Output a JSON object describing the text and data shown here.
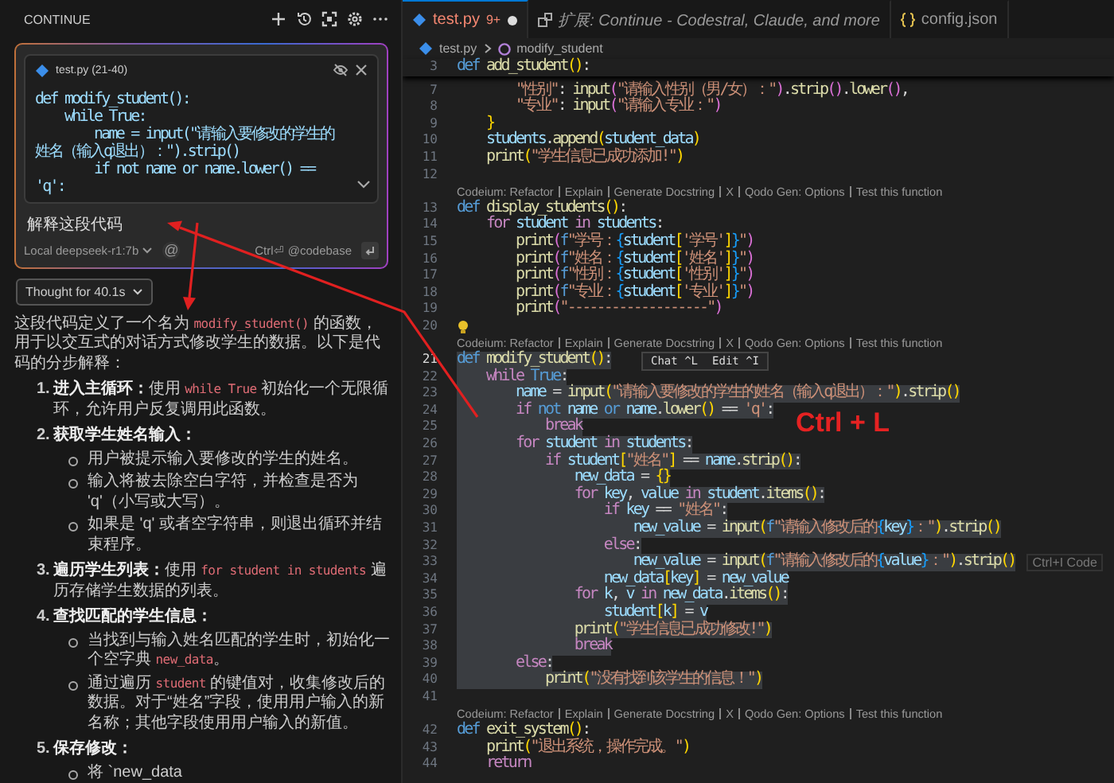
{
  "chat_panel": {
    "title": "CONTINUE",
    "context": {
      "file": "test.py (21-40)",
      "code": [
        "def modify_student():",
        "    while True:",
        "        name = input(\"请输入要修改的学生的姓名（输入q退出）：\").strip()",
        "        if not name or name.lower() == 'q':"
      ]
    },
    "prompt": "解释这段代码",
    "model": "Local deepseek-r1:7b",
    "mention": "@",
    "shortcut_hint": "Ctrl⏎ @codebase",
    "thought": "Thought for 40.1s",
    "answer": {
      "intro": [
        {
          "text": "这段代码定义了一个名为 ",
          "kind": "text"
        },
        {
          "text": "modify_student()",
          "kind": "code"
        },
        {
          "text": " 的函数，用于以交互式的对话方式修改学生的数据。以下是代码的分步解释：",
          "kind": "text"
        }
      ],
      "steps": [
        {
          "number": "1.",
          "title": "进入主循环：",
          "body": [
            {
              "text": "使用 ",
              "kind": "text"
            },
            {
              "text": "while True",
              "kind": "code"
            },
            {
              "text": " 初始化一个无限循环，允许用户反复调用此函数。",
              "kind": "text"
            }
          ]
        },
        {
          "number": "2.",
          "title": "获取学生姓名输入：",
          "bullets": [
            [
              {
                "text": "用户被提示输入要修改的学生的姓名。",
                "kind": "text"
              }
            ],
            [
              {
                "text": "输入将被去除空白字符，并检查是否为 'q'（小写或大写）。",
                "kind": "text"
              }
            ],
            [
              {
                "text": "如果是 'q' 或者空字符串，则退出循环并结束程序。",
                "kind": "text"
              }
            ]
          ]
        },
        {
          "number": "3.",
          "title": "遍历学生列表：",
          "body": [
            {
              "text": "使用 ",
              "kind": "text"
            },
            {
              "text": "for student in students",
              "kind": "code"
            },
            {
              "text": " 遍历存储学生数据的列表。",
              "kind": "text"
            }
          ]
        },
        {
          "number": "4.",
          "title": "查找匹配的学生信息：",
          "bullets": [
            [
              {
                "text": "当找到与输入姓名匹配的学生时，初始化一个空字典 ",
                "kind": "text"
              },
              {
                "text": "new_data",
                "kind": "code"
              },
              {
                "text": "。",
                "kind": "text"
              }
            ],
            [
              {
                "text": "通过遍历 ",
                "kind": "text"
              },
              {
                "text": "student",
                "kind": "code"
              },
              {
                "text": " 的键值对，收集修改后的数据。对于“姓名”字段，使用用户输入的新名称；其他字段使用用户输入的新值。",
                "kind": "text"
              }
            ]
          ]
        },
        {
          "number": "5.",
          "title": "保存修改：",
          "bullets": [
            [
              {
                "text": "将 `new_data",
                "kind": "text"
              }
            ]
          ]
        }
      ]
    }
  },
  "editor": {
    "tabs": [
      {
        "label": "test.py",
        "kind": "python",
        "badge": "9+",
        "modified": true,
        "preview": false,
        "selected": true
      },
      {
        "label": "扩展: Continue - Codestral, Claude, and more",
        "kind": "extension",
        "modified": false,
        "preview": true,
        "selected": false
      },
      {
        "label": "config.json",
        "kind": "json",
        "modified": false,
        "preview": false,
        "selected": false
      }
    ],
    "breadcrumb": [
      "test.py",
      "modify_student"
    ],
    "sticky_line": {
      "kind": "code",
      "number": "3",
      "selected": false,
      "current": false,
      "tokens": [
        {
          "text": "def ",
          "kind": "kw"
        },
        {
          "text": "add_student",
          "kind": "fn"
        },
        {
          "text": "()",
          "kind": "b1"
        },
        {
          "text": ":",
          "kind": "p"
        }
      ]
    },
    "rows": [
      {
        "kind": "code",
        "number": "7",
        "selected": false,
        "current": false,
        "tokens": [
          {
            "text": "        \"性别\"",
            "kind": "str"
          },
          {
            "text": ": ",
            "kind": "p"
          },
          {
            "text": "input",
            "kind": "fn"
          },
          {
            "text": "(",
            "kind": "b2"
          },
          {
            "text": "\"请输入性别（男/女）：\"",
            "kind": "str"
          },
          {
            "text": ")",
            "kind": "b2"
          },
          {
            "text": ".",
            "kind": "p"
          },
          {
            "text": "strip",
            "kind": "fn"
          },
          {
            "text": "()",
            "kind": "b2"
          },
          {
            "text": ".",
            "kind": "p"
          },
          {
            "text": "lower",
            "kind": "fn"
          },
          {
            "text": "()",
            "kind": "b2"
          },
          {
            "text": ",",
            "kind": "p"
          }
        ]
      },
      {
        "kind": "code",
        "number": "8",
        "selected": false,
        "current": false,
        "tokens": [
          {
            "text": "        \"专业\"",
            "kind": "str"
          },
          {
            "text": ": ",
            "kind": "p"
          },
          {
            "text": "input",
            "kind": "fn"
          },
          {
            "text": "(",
            "kind": "b2"
          },
          {
            "text": "\"请输入专业：\"",
            "kind": "str"
          },
          {
            "text": ")",
            "kind": "b2"
          }
        ]
      },
      {
        "kind": "code",
        "number": "9",
        "selected": false,
        "current": false,
        "tokens": [
          {
            "text": "    }",
            "kind": "b1"
          }
        ]
      },
      {
        "kind": "code",
        "number": "10",
        "selected": false,
        "current": false,
        "tokens": [
          {
            "text": "    students",
            "kind": "var"
          },
          {
            "text": ".",
            "kind": "p"
          },
          {
            "text": "append",
            "kind": "fn"
          },
          {
            "text": "(",
            "kind": "b1"
          },
          {
            "text": "student_data",
            "kind": "var"
          },
          {
            "text": ")",
            "kind": "b1"
          }
        ]
      },
      {
        "kind": "code",
        "number": "11",
        "selected": false,
        "current": false,
        "tokens": [
          {
            "text": "    print",
            "kind": "fn"
          },
          {
            "text": "(",
            "kind": "b1"
          },
          {
            "text": "\"学生信息已成功添加!\"",
            "kind": "str"
          },
          {
            "text": ")",
            "kind": "b1"
          }
        ]
      },
      {
        "kind": "code",
        "number": "12",
        "selected": false,
        "current": false
      },
      {
        "kind": "lens",
        "items": [
          "Codeium: Refactor",
          "Explain",
          "Generate Docstring",
          "X",
          "Qodo Gen: Options",
          "Test this function"
        ]
      },
      {
        "kind": "code",
        "number": "13",
        "selected": false,
        "current": false,
        "tokens": [
          {
            "text": "def ",
            "kind": "kw"
          },
          {
            "text": "display_students",
            "kind": "fn"
          },
          {
            "text": "()",
            "kind": "b1"
          },
          {
            "text": ":",
            "kind": "p"
          }
        ]
      },
      {
        "kind": "code",
        "number": "14",
        "selected": false,
        "current": false,
        "tokens": [
          {
            "text": "    for ",
            "kind": "ctl"
          },
          {
            "text": "student ",
            "kind": "var"
          },
          {
            "text": "in ",
            "kind": "ctl"
          },
          {
            "text": "students",
            "kind": "var"
          },
          {
            "text": ":",
            "kind": "p"
          }
        ]
      },
      {
        "kind": "code",
        "number": "15",
        "selected": false,
        "current": false,
        "tokens": [
          {
            "text": "        print",
            "kind": "fn"
          },
          {
            "text": "(",
            "kind": "b2"
          },
          {
            "text": "f",
            "kind": "kw"
          },
          {
            "text": "\"学号：",
            "kind": "str"
          },
          {
            "text": "{",
            "kind": "b3"
          },
          {
            "text": "student",
            "kind": "var"
          },
          {
            "text": "[",
            "kind": "b1"
          },
          {
            "text": "'学号'",
            "kind": "str"
          },
          {
            "text": "]",
            "kind": "b1"
          },
          {
            "text": "}",
            "kind": "b3"
          },
          {
            "text": "\"",
            "kind": "str"
          },
          {
            "text": ")",
            "kind": "b2"
          }
        ]
      },
      {
        "kind": "code",
        "number": "16",
        "selected": false,
        "current": false,
        "tokens": [
          {
            "text": "        print",
            "kind": "fn"
          },
          {
            "text": "(",
            "kind": "b2"
          },
          {
            "text": "f",
            "kind": "kw"
          },
          {
            "text": "\"姓名：",
            "kind": "str"
          },
          {
            "text": "{",
            "kind": "b3"
          },
          {
            "text": "student",
            "kind": "var"
          },
          {
            "text": "[",
            "kind": "b1"
          },
          {
            "text": "'姓名'",
            "kind": "str"
          },
          {
            "text": "]",
            "kind": "b1"
          },
          {
            "text": "}",
            "kind": "b3"
          },
          {
            "text": "\"",
            "kind": "str"
          },
          {
            "text": ")",
            "kind": "b2"
          }
        ]
      },
      {
        "kind": "code",
        "number": "17",
        "selected": false,
        "current": false,
        "tokens": [
          {
            "text": "        print",
            "kind": "fn"
          },
          {
            "text": "(",
            "kind": "b2"
          },
          {
            "text": "f",
            "kind": "kw"
          },
          {
            "text": "\"性别：",
            "kind": "str"
          },
          {
            "text": "{",
            "kind": "b3"
          },
          {
            "text": "student",
            "kind": "var"
          },
          {
            "text": "[",
            "kind": "b1"
          },
          {
            "text": "'性别'",
            "kind": "str"
          },
          {
            "text": "]",
            "kind": "b1"
          },
          {
            "text": "}",
            "kind": "b3"
          },
          {
            "text": "\"",
            "kind": "str"
          },
          {
            "text": ")",
            "kind": "b2"
          }
        ]
      },
      {
        "kind": "code",
        "number": "18",
        "selected": false,
        "current": false,
        "tokens": [
          {
            "text": "        print",
            "kind": "fn"
          },
          {
            "text": "(",
            "kind": "b2"
          },
          {
            "text": "f",
            "kind": "kw"
          },
          {
            "text": "\"专业：",
            "kind": "str"
          },
          {
            "text": "{",
            "kind": "b3"
          },
          {
            "text": "student",
            "kind": "var"
          },
          {
            "text": "[",
            "kind": "b1"
          },
          {
            "text": "'专业'",
            "kind": "str"
          },
          {
            "text": "]",
            "kind": "b1"
          },
          {
            "text": "}",
            "kind": "b3"
          },
          {
            "text": "\"",
            "kind": "str"
          },
          {
            "text": ")",
            "kind": "b2"
          }
        ]
      },
      {
        "kind": "code",
        "number": "19",
        "selected": false,
        "current": false,
        "tokens": [
          {
            "text": "        print",
            "kind": "fn"
          },
          {
            "text": "(",
            "kind": "b2"
          },
          {
            "text": "\"-------------------\"",
            "kind": "str"
          },
          {
            "text": ")",
            "kind": "b2"
          }
        ]
      },
      {
        "kind": "code",
        "number": "20",
        "selected": false,
        "current": false,
        "lightbulb": true
      },
      {
        "kind": "lens",
        "items": [
          "Codeium: Refactor",
          "Explain",
          "Generate Docstring",
          "X",
          "Qodo Gen: Options",
          "Test this function"
        ]
      },
      {
        "kind": "code",
        "number": "21",
        "selected": true,
        "current": true,
        "actions": [
          "Chat ^L",
          "Edit ^I"
        ],
        "tokens": [
          {
            "text": "def ",
            "kind": "kw"
          },
          {
            "text": "modify_student",
            "kind": "fn"
          },
          {
            "text": "()",
            "kind": "b1"
          },
          {
            "text": ":",
            "kind": "p"
          }
        ]
      },
      {
        "kind": "code",
        "number": "22",
        "selected": true,
        "current": false,
        "tokens": [
          {
            "text": "    while ",
            "kind": "ctl"
          },
          {
            "text": "True",
            "kind": "kw"
          },
          {
            "text": ":",
            "kind": "p"
          }
        ]
      },
      {
        "kind": "code",
        "number": "23",
        "selected": true,
        "current": false,
        "tokens": [
          {
            "text": "        name",
            "kind": "var"
          },
          {
            "text": " = ",
            "kind": "p"
          },
          {
            "text": "input",
            "kind": "fn"
          },
          {
            "text": "(",
            "kind": "b1"
          },
          {
            "text": "\"请输入要修改的学生的姓名（输入q退出）：\"",
            "kind": "str"
          },
          {
            "text": ")",
            "kind": "b1"
          },
          {
            "text": ".",
            "kind": "p"
          },
          {
            "text": "strip",
            "kind": "fn"
          },
          {
            "text": "()",
            "kind": "b1"
          }
        ]
      },
      {
        "kind": "code",
        "number": "24",
        "selected": true,
        "current": false,
        "tokens": [
          {
            "text": "        if ",
            "kind": "ctl"
          },
          {
            "text": "not ",
            "kind": "kw"
          },
          {
            "text": "name ",
            "kind": "var"
          },
          {
            "text": "or ",
            "kind": "kw"
          },
          {
            "text": "name",
            "kind": "var"
          },
          {
            "text": ".",
            "kind": "p"
          },
          {
            "text": "lower",
            "kind": "fn"
          },
          {
            "text": "()",
            "kind": "b1"
          },
          {
            "text": " == ",
            "kind": "p"
          },
          {
            "text": "'q'",
            "kind": "str"
          },
          {
            "text": ":",
            "kind": "p"
          }
        ]
      },
      {
        "kind": "code",
        "number": "25",
        "selected": true,
        "current": false,
        "tokens": [
          {
            "text": "            break",
            "kind": "ctl"
          }
        ]
      },
      {
        "kind": "code",
        "number": "26",
        "selected": true,
        "current": false,
        "tokens": [
          {
            "text": "        for ",
            "kind": "ctl"
          },
          {
            "text": "student ",
            "kind": "var"
          },
          {
            "text": "in ",
            "kind": "ctl"
          },
          {
            "text": "students",
            "kind": "var"
          },
          {
            "text": ":",
            "kind": "p"
          }
        ]
      },
      {
        "kind": "code",
        "number": "27",
        "selected": true,
        "current": false,
        "tokens": [
          {
            "text": "            if ",
            "kind": "ctl"
          },
          {
            "text": "student",
            "kind": "var"
          },
          {
            "text": "[",
            "kind": "b1"
          },
          {
            "text": "\"姓名\"",
            "kind": "str"
          },
          {
            "text": "]",
            "kind": "b1"
          },
          {
            "text": " == ",
            "kind": "p"
          },
          {
            "text": "name",
            "kind": "var"
          },
          {
            "text": ".",
            "kind": "p"
          },
          {
            "text": "strip",
            "kind": "fn"
          },
          {
            "text": "()",
            "kind": "b1"
          },
          {
            "text": ":",
            "kind": "p"
          }
        ]
      },
      {
        "kind": "code",
        "number": "28",
        "selected": true,
        "current": false,
        "tokens": [
          {
            "text": "                new_data",
            "kind": "var"
          },
          {
            "text": " = ",
            "kind": "p"
          },
          {
            "text": "{}",
            "kind": "b1"
          }
        ]
      },
      {
        "kind": "code",
        "number": "29",
        "selected": true,
        "current": false,
        "tokens": [
          {
            "text": "                for ",
            "kind": "ctl"
          },
          {
            "text": "key",
            "kind": "var"
          },
          {
            "text": ", ",
            "kind": "p"
          },
          {
            "text": "value ",
            "kind": "var"
          },
          {
            "text": "in ",
            "kind": "ctl"
          },
          {
            "text": "student",
            "kind": "var"
          },
          {
            "text": ".",
            "kind": "p"
          },
          {
            "text": "items",
            "kind": "fn"
          },
          {
            "text": "()",
            "kind": "b1"
          },
          {
            "text": ":",
            "kind": "p"
          }
        ]
      },
      {
        "kind": "code",
        "number": "30",
        "selected": true,
        "current": false,
        "tokens": [
          {
            "text": "                    if ",
            "kind": "ctl"
          },
          {
            "text": "key",
            "kind": "var"
          },
          {
            "text": " == ",
            "kind": "p"
          },
          {
            "text": "\"姓名\"",
            "kind": "str"
          },
          {
            "text": ":",
            "kind": "p"
          }
        ]
      },
      {
        "kind": "code",
        "number": "31",
        "selected": true,
        "current": false,
        "tokens": [
          {
            "text": "                        new_value",
            "kind": "var"
          },
          {
            "text": " = ",
            "kind": "p"
          },
          {
            "text": "input",
            "kind": "fn"
          },
          {
            "text": "(",
            "kind": "b1"
          },
          {
            "text": "f",
            "kind": "kw"
          },
          {
            "text": "\"请输入修改后的",
            "kind": "str"
          },
          {
            "text": "{",
            "kind": "b3"
          },
          {
            "text": "key",
            "kind": "var"
          },
          {
            "text": "}",
            "kind": "b3"
          },
          {
            "text": "：\"",
            "kind": "str"
          },
          {
            "text": ")",
            "kind": "b1"
          },
          {
            "text": ".",
            "kind": "p"
          },
          {
            "text": "strip",
            "kind": "fn"
          },
          {
            "text": "()",
            "kind": "b1"
          }
        ]
      },
      {
        "kind": "code",
        "number": "32",
        "selected": true,
        "current": false,
        "tokens": [
          {
            "text": "                    else",
            "kind": "ctl"
          },
          {
            "text": ":",
            "kind": "p"
          }
        ]
      },
      {
        "kind": "code",
        "number": "33",
        "selected": true,
        "current": false,
        "hint": "Ctrl+I Code",
        "tokens": [
          {
            "text": "                        new_value",
            "kind": "var"
          },
          {
            "text": " = ",
            "kind": "p"
          },
          {
            "text": "input",
            "kind": "fn"
          },
          {
            "text": "(",
            "kind": "b1"
          },
          {
            "text": "f",
            "kind": "kw"
          },
          {
            "text": "\"请输入修改后的",
            "kind": "str"
          },
          {
            "text": "{",
            "kind": "b3"
          },
          {
            "text": "value",
            "kind": "var"
          },
          {
            "text": "}",
            "kind": "b3"
          },
          {
            "text": "：\"",
            "kind": "str"
          },
          {
            "text": ")",
            "kind": "b1"
          },
          {
            "text": ".",
            "kind": "p"
          },
          {
            "text": "strip",
            "kind": "fn"
          },
          {
            "text": "()",
            "kind": "b1"
          }
        ]
      },
      {
        "kind": "code",
        "number": "34",
        "selected": true,
        "current": false,
        "tokens": [
          {
            "text": "                    new_data",
            "kind": "var"
          },
          {
            "text": "[",
            "kind": "b1"
          },
          {
            "text": "key",
            "kind": "var"
          },
          {
            "text": "]",
            "kind": "b1"
          },
          {
            "text": " = ",
            "kind": "p"
          },
          {
            "text": "new_value",
            "kind": "var"
          }
        ]
      },
      {
        "kind": "code",
        "number": "35",
        "selected": true,
        "current": false,
        "tokens": [
          {
            "text": "                for ",
            "kind": "ctl"
          },
          {
            "text": "k",
            "kind": "var"
          },
          {
            "text": ", ",
            "kind": "p"
          },
          {
            "text": "v ",
            "kind": "var"
          },
          {
            "text": "in ",
            "kind": "ctl"
          },
          {
            "text": "new_data",
            "kind": "var"
          },
          {
            "text": ".",
            "kind": "p"
          },
          {
            "text": "items",
            "kind": "fn"
          },
          {
            "text": "()",
            "kind": "b1"
          },
          {
            "text": ":",
            "kind": "p"
          }
        ]
      },
      {
        "kind": "code",
        "number": "36",
        "selected": true,
        "current": false,
        "tokens": [
          {
            "text": "                    student",
            "kind": "var"
          },
          {
            "text": "[",
            "kind": "b1"
          },
          {
            "text": "k",
            "kind": "var"
          },
          {
            "text": "]",
            "kind": "b1"
          },
          {
            "text": " = ",
            "kind": "p"
          },
          {
            "text": "v",
            "kind": "var"
          }
        ]
      },
      {
        "kind": "code",
        "number": "37",
        "selected": true,
        "current": false,
        "tokens": [
          {
            "text": "                print",
            "kind": "fn"
          },
          {
            "text": "(",
            "kind": "b1"
          },
          {
            "text": "\"学生信息已成功修改!\"",
            "kind": "str"
          },
          {
            "text": ")",
            "kind": "b1"
          }
        ]
      },
      {
        "kind": "code",
        "number": "38",
        "selected": true,
        "current": false,
        "tokens": [
          {
            "text": "                break",
            "kind": "ctl"
          }
        ]
      },
      {
        "kind": "code",
        "number": "39",
        "selected": true,
        "current": false,
        "tokens": [
          {
            "text": "        else",
            "kind": "ctl"
          },
          {
            "text": ":",
            "kind": "p"
          }
        ]
      },
      {
        "kind": "code",
        "number": "40",
        "selected": true,
        "current": false,
        "tokens": [
          {
            "text": "            print",
            "kind": "fn"
          },
          {
            "text": "(",
            "kind": "b1"
          },
          {
            "text": "\"没有找到该学生的信息！\"",
            "kind": "str"
          },
          {
            "text": ")",
            "kind": "b1"
          }
        ]
      },
      {
        "kind": "code",
        "number": "41",
        "selected": false,
        "current": false
      },
      {
        "kind": "lens",
        "items": [
          "Codeium: Refactor",
          "Explain",
          "Generate Docstring",
          "X",
          "Qodo Gen: Options",
          "Test this function"
        ]
      },
      {
        "kind": "code",
        "number": "42",
        "selected": false,
        "current": false,
        "tokens": [
          {
            "text": "def ",
            "kind": "kw"
          },
          {
            "text": "exit_system",
            "kind": "fn"
          },
          {
            "text": "()",
            "kind": "b1"
          },
          {
            "text": ":",
            "kind": "p"
          }
        ]
      },
      {
        "kind": "code",
        "number": "43",
        "selected": false,
        "current": false,
        "tokens": [
          {
            "text": "    print",
            "kind": "fn"
          },
          {
            "text": "(",
            "kind": "b1"
          },
          {
            "text": "\"退出系统，操作完成。\"",
            "kind": "str"
          },
          {
            "text": ")",
            "kind": "b1"
          }
        ]
      },
      {
        "kind": "code",
        "number": "44",
        "selected": false,
        "current": false,
        "tokens": [
          {
            "text": "    return",
            "kind": "ctl"
          }
        ]
      }
    ]
  },
  "annotation": {
    "label": "Ctrl + L"
  }
}
